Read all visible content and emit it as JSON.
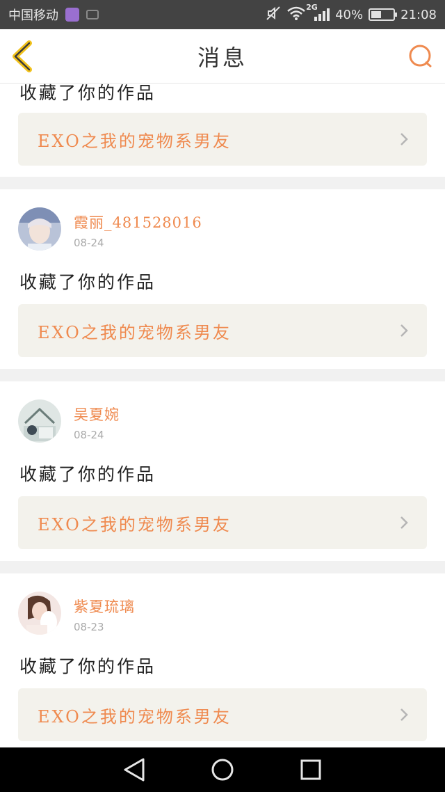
{
  "status_bar": {
    "carrier": "中国移动",
    "network": "2G",
    "battery": "40%",
    "time": "21:08"
  },
  "header": {
    "title": "消息"
  },
  "colors": {
    "accent": "#ef8a4f",
    "back_icon": "#f2c21b",
    "work_box_bg": "#f3f2ec"
  },
  "feed": {
    "partial_item": {
      "action": "收藏了你的作品",
      "work_title": "EXO之我的宠物系男友"
    },
    "items": [
      {
        "user": "霞丽_481528016",
        "time": "08-24",
        "action": "收藏了你的作品",
        "work_title": "EXO之我的宠物系男友"
      },
      {
        "user": "吴夏婉",
        "time": "08-24",
        "action": "收藏了你的作品",
        "work_title": "EXO之我的宠物系男友"
      },
      {
        "user": "紫夏琉璃",
        "time": "08-23",
        "action": "收藏了你的作品",
        "work_title": "EXO之我的宠物系男友"
      }
    ]
  },
  "nav_bar": {
    "icons": [
      "back-triangle-icon",
      "home-circle-icon",
      "recents-square-icon"
    ]
  }
}
